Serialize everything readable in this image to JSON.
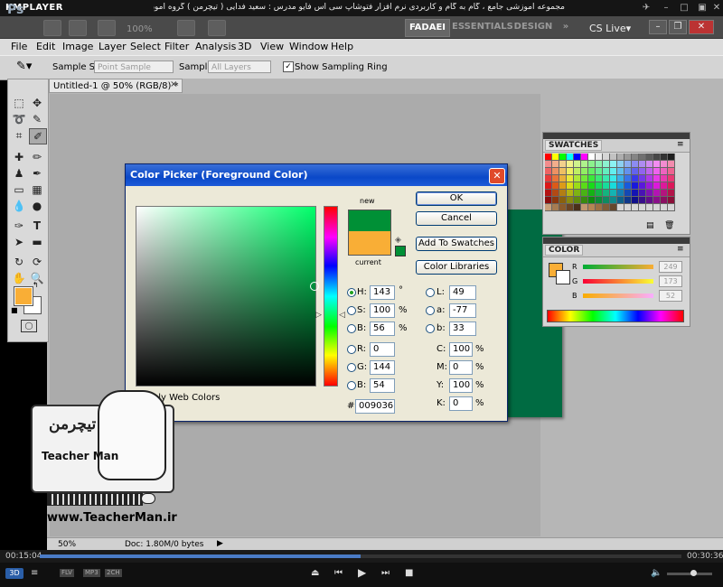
{
  "player": {
    "logo": "KMPLAYER",
    "caption": "مجموعه آموزشی جامع ، گام به گام و کاربردی نرم افزار فتوشاپ سی اس فایو مدرس : سعید فدایی ( تیچرمن ) گروه آموزشی پادشاه گرافیست ها",
    "time_elapsed": "00:15:04",
    "time_total": "00:30:36",
    "progress_fraction": 0.5,
    "badges": [
      "FLV",
      "MP3",
      "2CH"
    ],
    "mode_label": "3D"
  },
  "appbar": {
    "logo": "Ps",
    "zoom": "100%",
    "workspaces": [
      "FADAEI",
      "ESSENTIALS",
      "DESIGN"
    ],
    "more": "»",
    "cslive": "CS Live▾"
  },
  "menu": [
    "File",
    "Edit",
    "Image",
    "Layer",
    "Select",
    "Filter",
    "Analysis",
    "3D",
    "View",
    "Window",
    "Help"
  ],
  "options": {
    "sample_size_label": "Sample Size:",
    "sample_size_value": "Point Sample",
    "sample_label": "Sample:",
    "sample_value": "All Layers",
    "show_ring_label": "Show Sampling Ring",
    "show_ring_checked": "✓"
  },
  "document": {
    "tab_title": "Untitled-1 @ 50% (RGB/8) *",
    "close": "×",
    "canvas_color": "#006b42"
  },
  "status": {
    "zoom": "50%",
    "doc_info": "Doc: 1.80M/0 bytes"
  },
  "panels": {
    "swatches_title": "SWATCHES",
    "color_title": "COLOR",
    "color_channels": [
      {
        "label": "R",
        "value": "249"
      },
      {
        "label": "G",
        "value": "173"
      },
      {
        "label": "B",
        "value": "52"
      }
    ]
  },
  "dialog": {
    "title": "Color Picker (Foreground Color)",
    "close": "✕",
    "new_label": "new",
    "current_label": "current",
    "new_color": "#009036",
    "current_color": "#f9ae36",
    "buttons": {
      "ok": "OK",
      "cancel": "Cancel",
      "add_swatches": "Add To Swatches",
      "libraries": "Color Libraries"
    },
    "fields_left": [
      {
        "label": "H:",
        "value": "143",
        "unit": "°"
      },
      {
        "label": "S:",
        "value": "100",
        "unit": "%"
      },
      {
        "label": "B:",
        "value": "56",
        "unit": "%"
      },
      {
        "label": "R:",
        "value": "0",
        "unit": ""
      },
      {
        "label": "G:",
        "value": "144",
        "unit": ""
      },
      {
        "label": "B:",
        "value": "54",
        "unit": ""
      }
    ],
    "fields_lab": [
      {
        "label": "L:",
        "value": "49"
      },
      {
        "label": "a:",
        "value": "-77"
      },
      {
        "label": "b:",
        "value": "33"
      }
    ],
    "fields_cmyk": [
      {
        "label": "C:",
        "value": "100",
        "unit": "%"
      },
      {
        "label": "M:",
        "value": "0",
        "unit": "%"
      },
      {
        "label": "Y:",
        "value": "100",
        "unit": "%"
      },
      {
        "label": "K:",
        "value": "0",
        "unit": "%"
      }
    ],
    "hex_label": "#",
    "hex_value": "009036",
    "web_colors_label": "Only Web Colors"
  },
  "watermark": {
    "logo_text": "تیچرمن",
    "tagline": "Teacher Man",
    "url": "www.TeacherMan.ir"
  }
}
